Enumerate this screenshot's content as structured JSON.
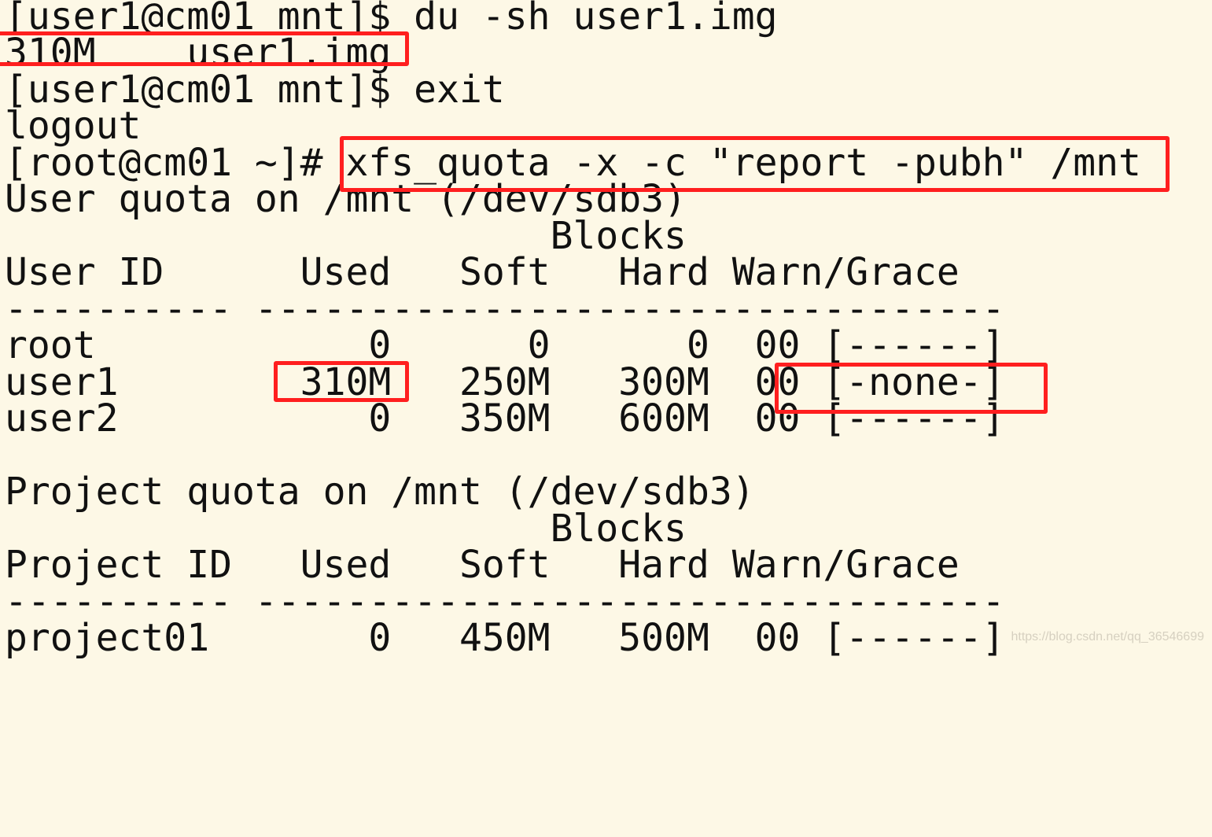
{
  "terminal": {
    "lines": [
      "[user1@cm01 mnt]$ du -sh user1.img",
      "310M    user1.img",
      "[user1@cm01 mnt]$ exit",
      "logout",
      "[root@cm01 ~]# xfs_quota -x -c \"report -pubh\" /mnt",
      "User quota on /mnt (/dev/sdb3)",
      "                        Blocks",
      "User ID      Used   Soft   Hard Warn/Grace",
      "---------- ---------------------------------",
      "root            0      0      0  00 [------]",
      "user1        310M   250M   300M  00 [-none-]",
      "user2           0   350M   600M  00 [------]",
      "",
      "Project quota on /mnt (/dev/sdb3)",
      "                        Blocks",
      "Project ID   Used   Soft   Hard Warn/Grace",
      "---------- ---------------------------------",
      "project01       0   450M   500M  00 [------]"
    ]
  },
  "watermark": "https://blog.csdn.net/qq_36546699",
  "colors": {
    "background": "#fdf8e6",
    "text": "#111111",
    "highlight": "#ff1f1f"
  }
}
